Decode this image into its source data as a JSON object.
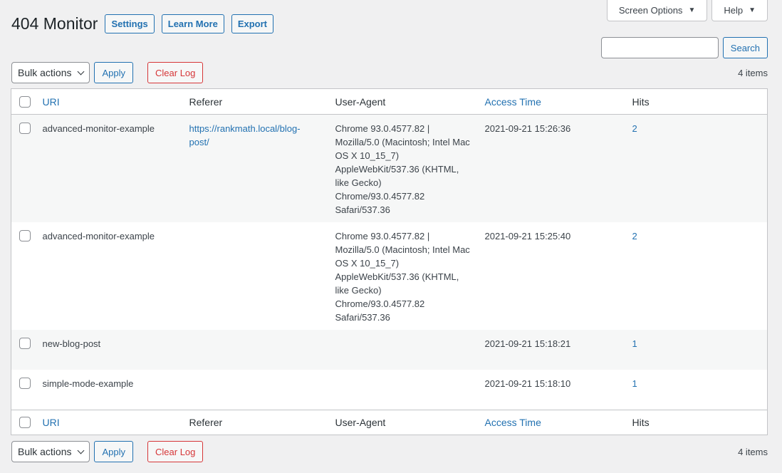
{
  "page": {
    "title": "404 Monitor",
    "buttons": {
      "settings": "Settings",
      "learn_more": "Learn More",
      "export": "Export"
    }
  },
  "screen_meta": {
    "screen_options": "Screen Options",
    "help": "Help"
  },
  "search": {
    "placeholder": "",
    "button": "Search"
  },
  "tablenav": {
    "bulk_actions": "Bulk actions",
    "apply": "Apply",
    "clear_log": "Clear Log",
    "items_count": "4 items"
  },
  "table": {
    "columns": {
      "uri": "URI",
      "referer": "Referer",
      "user_agent": "User-Agent",
      "access_time": "Access Time",
      "hits": "Hits"
    },
    "rows": [
      {
        "uri": "advanced-monitor-example",
        "referer": "https://rankmath.local/blog-post/",
        "user_agent": "Chrome 93.0.4577.82 | Mozilla/5.0 (Macintosh; Intel Mac OS X 10_15_7) AppleWebKit/537.36 (KHTML, like Gecko) Chrome/93.0.4577.82 Safari/537.36",
        "access_time": "2021-09-21 15:26:36",
        "hits": "2"
      },
      {
        "uri": "advanced-monitor-example",
        "referer": "",
        "user_agent": "Chrome 93.0.4577.82 | Mozilla/5.0 (Macintosh; Intel Mac OS X 10_15_7) AppleWebKit/537.36 (KHTML, like Gecko) Chrome/93.0.4577.82 Safari/537.36",
        "access_time": "2021-09-21 15:25:40",
        "hits": "2"
      },
      {
        "uri": "new-blog-post",
        "referer": "",
        "user_agent": "",
        "access_time": "2021-09-21 15:18:21",
        "hits": "1"
      },
      {
        "uri": "simple-mode-example",
        "referer": "",
        "user_agent": "",
        "access_time": "2021-09-21 15:18:10",
        "hits": "1"
      }
    ]
  },
  "colors": {
    "link": "#2271b1",
    "danger": "#d63638",
    "background": "#f0f0f1"
  }
}
